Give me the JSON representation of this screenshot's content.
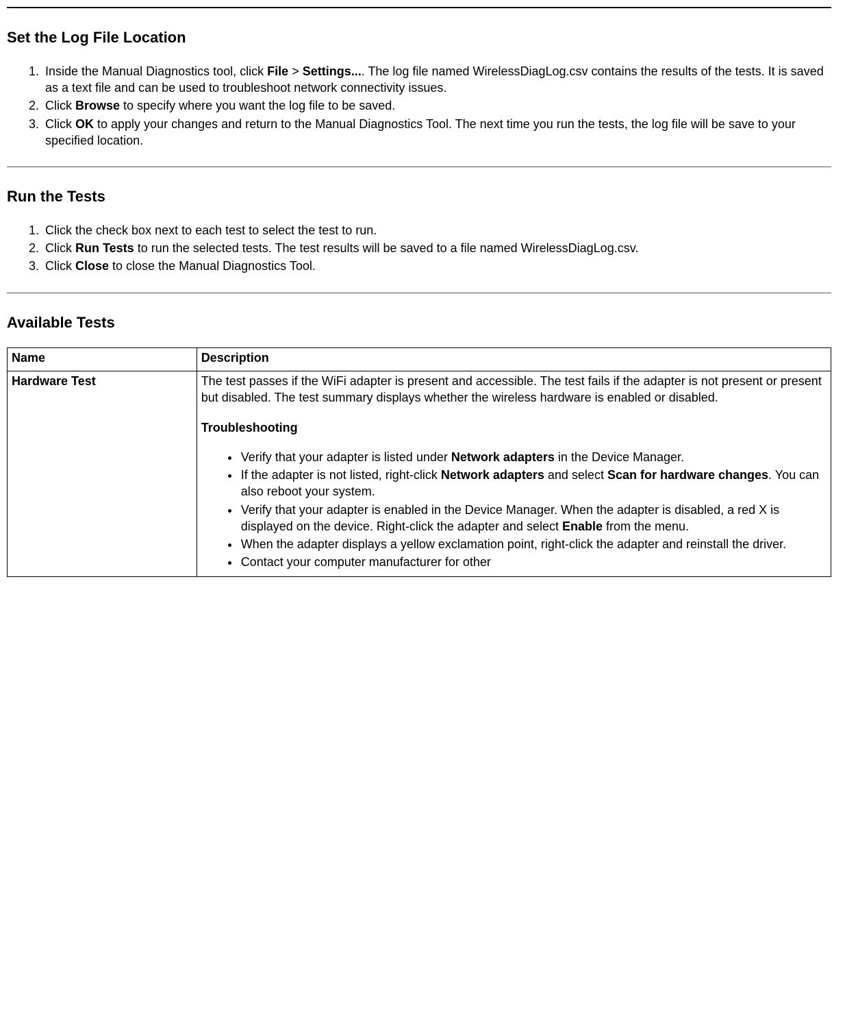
{
  "section1": {
    "heading": "Set the Log File Location",
    "li1_a": "Inside the Manual Diagnostics tool, click ",
    "li1_b1": "File",
    "li1_gt": " > ",
    "li1_b2": "Settings...",
    "li1_c": ". The log file named WirelessDiagLog.csv contains the results of the tests. It is saved as a text file and can be used to troubleshoot network connectivity issues.",
    "li2_a": "Click ",
    "li2_b": "Browse",
    "li2_c": " to specify where you want the log file to be saved.",
    "li3_a": "Click ",
    "li3_b": "OK",
    "li3_c": " to apply your changes and return to the Manual Diagnostics Tool. The next time you run the tests, the log file will be save to your specified location."
  },
  "section2": {
    "heading": "Run the Tests",
    "li1": "Click the check box next to each test to select the test to run.",
    "li2_a": "Click ",
    "li2_b": "Run Tests",
    "li2_c": " to run the selected tests. The test results will be saved to a file named WirelessDiagLog.csv.",
    "li3_a": "Click ",
    "li3_b": "Close",
    "li3_c": " to close the Manual Diagnostics Tool."
  },
  "section3": {
    "heading": "Available Tests",
    "th_name": "Name",
    "th_desc": "Description",
    "row1_name": "Hardware Test",
    "row1_para": "The test passes if the WiFi adapter is present and accessible. The test fails if the adapter is not present or present but disabled. The test summary displays whether the wireless hardware is enabled or disabled.",
    "row1_trouble_label": "Troubleshooting",
    "row1_b1_a": "Verify that your adapter is listed under ",
    "row1_b1_b": "Network adapters",
    "row1_b1_c": " in the Device Manager.",
    "row1_b2_a": "If the adapter is not listed, right-click ",
    "row1_b2_b": "Network adapters",
    "row1_b2_c": " and select ",
    "row1_b2_d": "Scan for hardware changes",
    "row1_b2_e": ". You can also reboot your system.",
    "row1_b3_a": "Verify that your adapter is enabled in the Device Manager. When the adapter is disabled, a red X is displayed on the device. Right-click the adapter and select ",
    "row1_b3_b": "Enable",
    "row1_b3_c": " from the menu.",
    "row1_b4": "When the adapter displays a yellow exclamation point, right-click the adapter and reinstall the driver.",
    "row1_b5": "Contact your computer manufacturer for other"
  }
}
